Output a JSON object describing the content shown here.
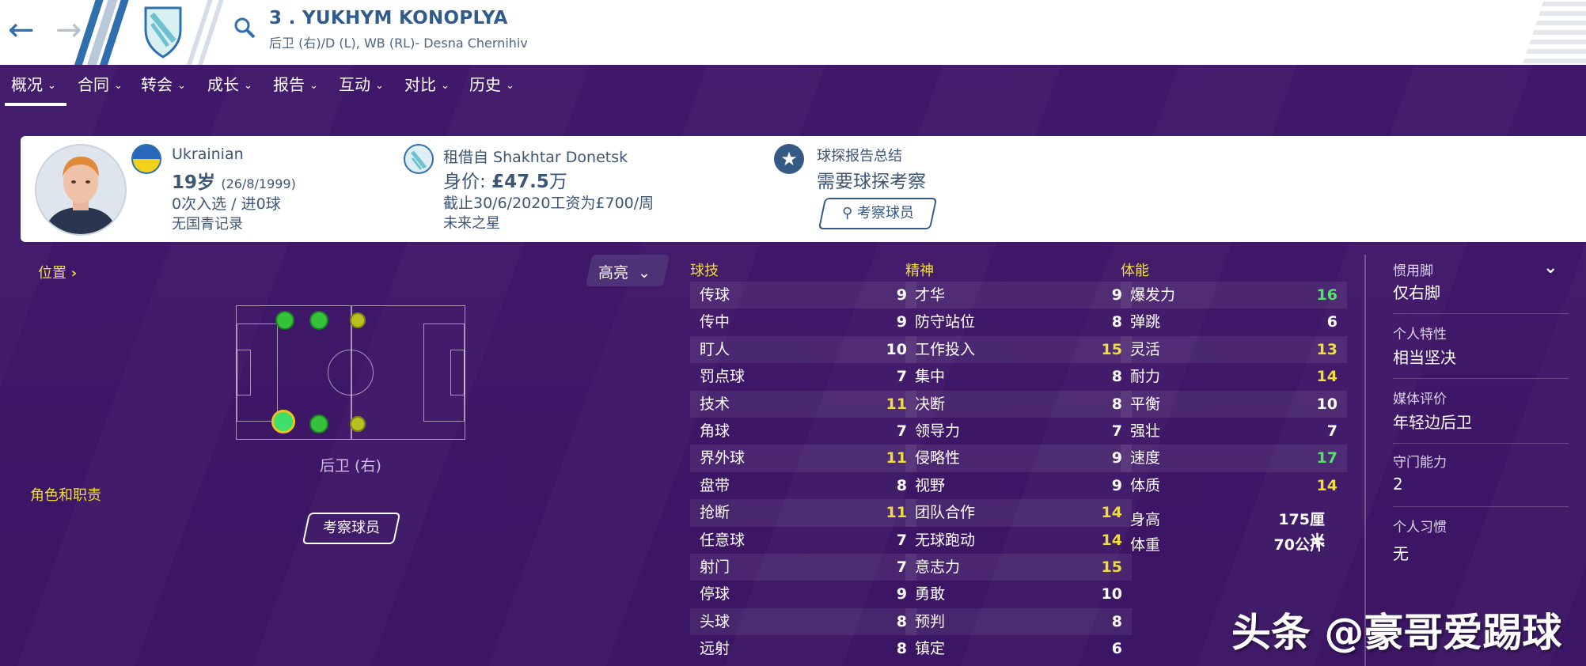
{
  "player": {
    "name": "3 . YUKHYM KONOPLYA",
    "subtitle": "后卫 (右)/D (L), WB (RL)- Desna Chernihiv"
  },
  "tabs": [
    {
      "label": "概况"
    },
    {
      "label": "合同"
    },
    {
      "label": "转会"
    },
    {
      "label": "成长"
    },
    {
      "label": "报告"
    },
    {
      "label": "互动"
    },
    {
      "label": "对比"
    },
    {
      "label": "历史"
    }
  ],
  "card": {
    "nationality": "Ukrainian",
    "age": "19岁",
    "birth": "(26/8/1999)",
    "caps": "0次入选 / 进0球",
    "youth": "无国青记录",
    "loan": "租借自 Shakhtar Donetsk",
    "value_label": "身价: ",
    "value_amount": "£47.5",
    "value_unit": "万",
    "wage": "截止30/6/2020工资为£700/周",
    "status": "未来之星",
    "report_title": "球探报告总结",
    "report_text": "需要球探考察",
    "scout_button": "考察球员"
  },
  "left": {
    "position_link": "位置",
    "position_name": "后卫 (右)",
    "roles_label": "角色和职责",
    "scout_button": "考察球员",
    "highlight": "高亮"
  },
  "attributes": {
    "technical_header": "球技",
    "mental_header": "精神",
    "physical_header": "体能",
    "technical": [
      {
        "name": "传球",
        "value": "9"
      },
      {
        "name": "传中",
        "value": "9"
      },
      {
        "name": "盯人",
        "value": "10"
      },
      {
        "name": "罚点球",
        "value": "7"
      },
      {
        "name": "技术",
        "value": "11"
      },
      {
        "name": "角球",
        "value": "7"
      },
      {
        "name": "界外球",
        "value": "11"
      },
      {
        "name": "盘带",
        "value": "8"
      },
      {
        "name": "抢断",
        "value": "11"
      },
      {
        "name": "任意球",
        "value": "7"
      },
      {
        "name": "射门",
        "value": "7"
      },
      {
        "name": "停球",
        "value": "9"
      },
      {
        "name": "头球",
        "value": "8"
      },
      {
        "name": "远射",
        "value": "8"
      }
    ],
    "mental": [
      {
        "name": "才华",
        "value": "9"
      },
      {
        "name": "防守站位",
        "value": "8"
      },
      {
        "name": "工作投入",
        "value": "15"
      },
      {
        "name": "集中",
        "value": "8"
      },
      {
        "name": "决断",
        "value": "8"
      },
      {
        "name": "领导力",
        "value": "7"
      },
      {
        "name": "侵略性",
        "value": "9"
      },
      {
        "name": "视野",
        "value": "9"
      },
      {
        "name": "团队合作",
        "value": "14"
      },
      {
        "name": "无球跑动",
        "value": "14"
      },
      {
        "name": "意志力",
        "value": "15"
      },
      {
        "name": "勇敢",
        "value": "10"
      },
      {
        "name": "预判",
        "value": "8"
      },
      {
        "name": "镇定",
        "value": "6"
      }
    ],
    "physical": [
      {
        "name": "爆发力",
        "value": "16"
      },
      {
        "name": "弹跳",
        "value": "6"
      },
      {
        "name": "灵活",
        "value": "13"
      },
      {
        "name": "耐力",
        "value": "14"
      },
      {
        "name": "平衡",
        "value": "10"
      },
      {
        "name": "强壮",
        "value": "7"
      },
      {
        "name": "速度",
        "value": "17"
      },
      {
        "name": "体质",
        "value": "14"
      }
    ],
    "height_label": "身高",
    "height_value": "175厘米",
    "weight_label": "体重",
    "weight_value": "70公斤"
  },
  "sidebar": {
    "foot_label": "惯用脚",
    "foot_value": "仅右脚",
    "trait_label": "个人特性",
    "trait_value": "相当坚决",
    "media_label": "媒体评价",
    "media_value": "年轻边后卫",
    "gk_label": "守门能力",
    "gk_value": "2",
    "habit_label": "个人习惯",
    "habit_value": "无"
  },
  "watermark": "头条 @豪哥爱踢球",
  "colors": {
    "background": "#3b1664",
    "accent_yellow": "#f1dd3a",
    "good_green": "#55e26a",
    "header_blue": "#2f5b8e"
  }
}
